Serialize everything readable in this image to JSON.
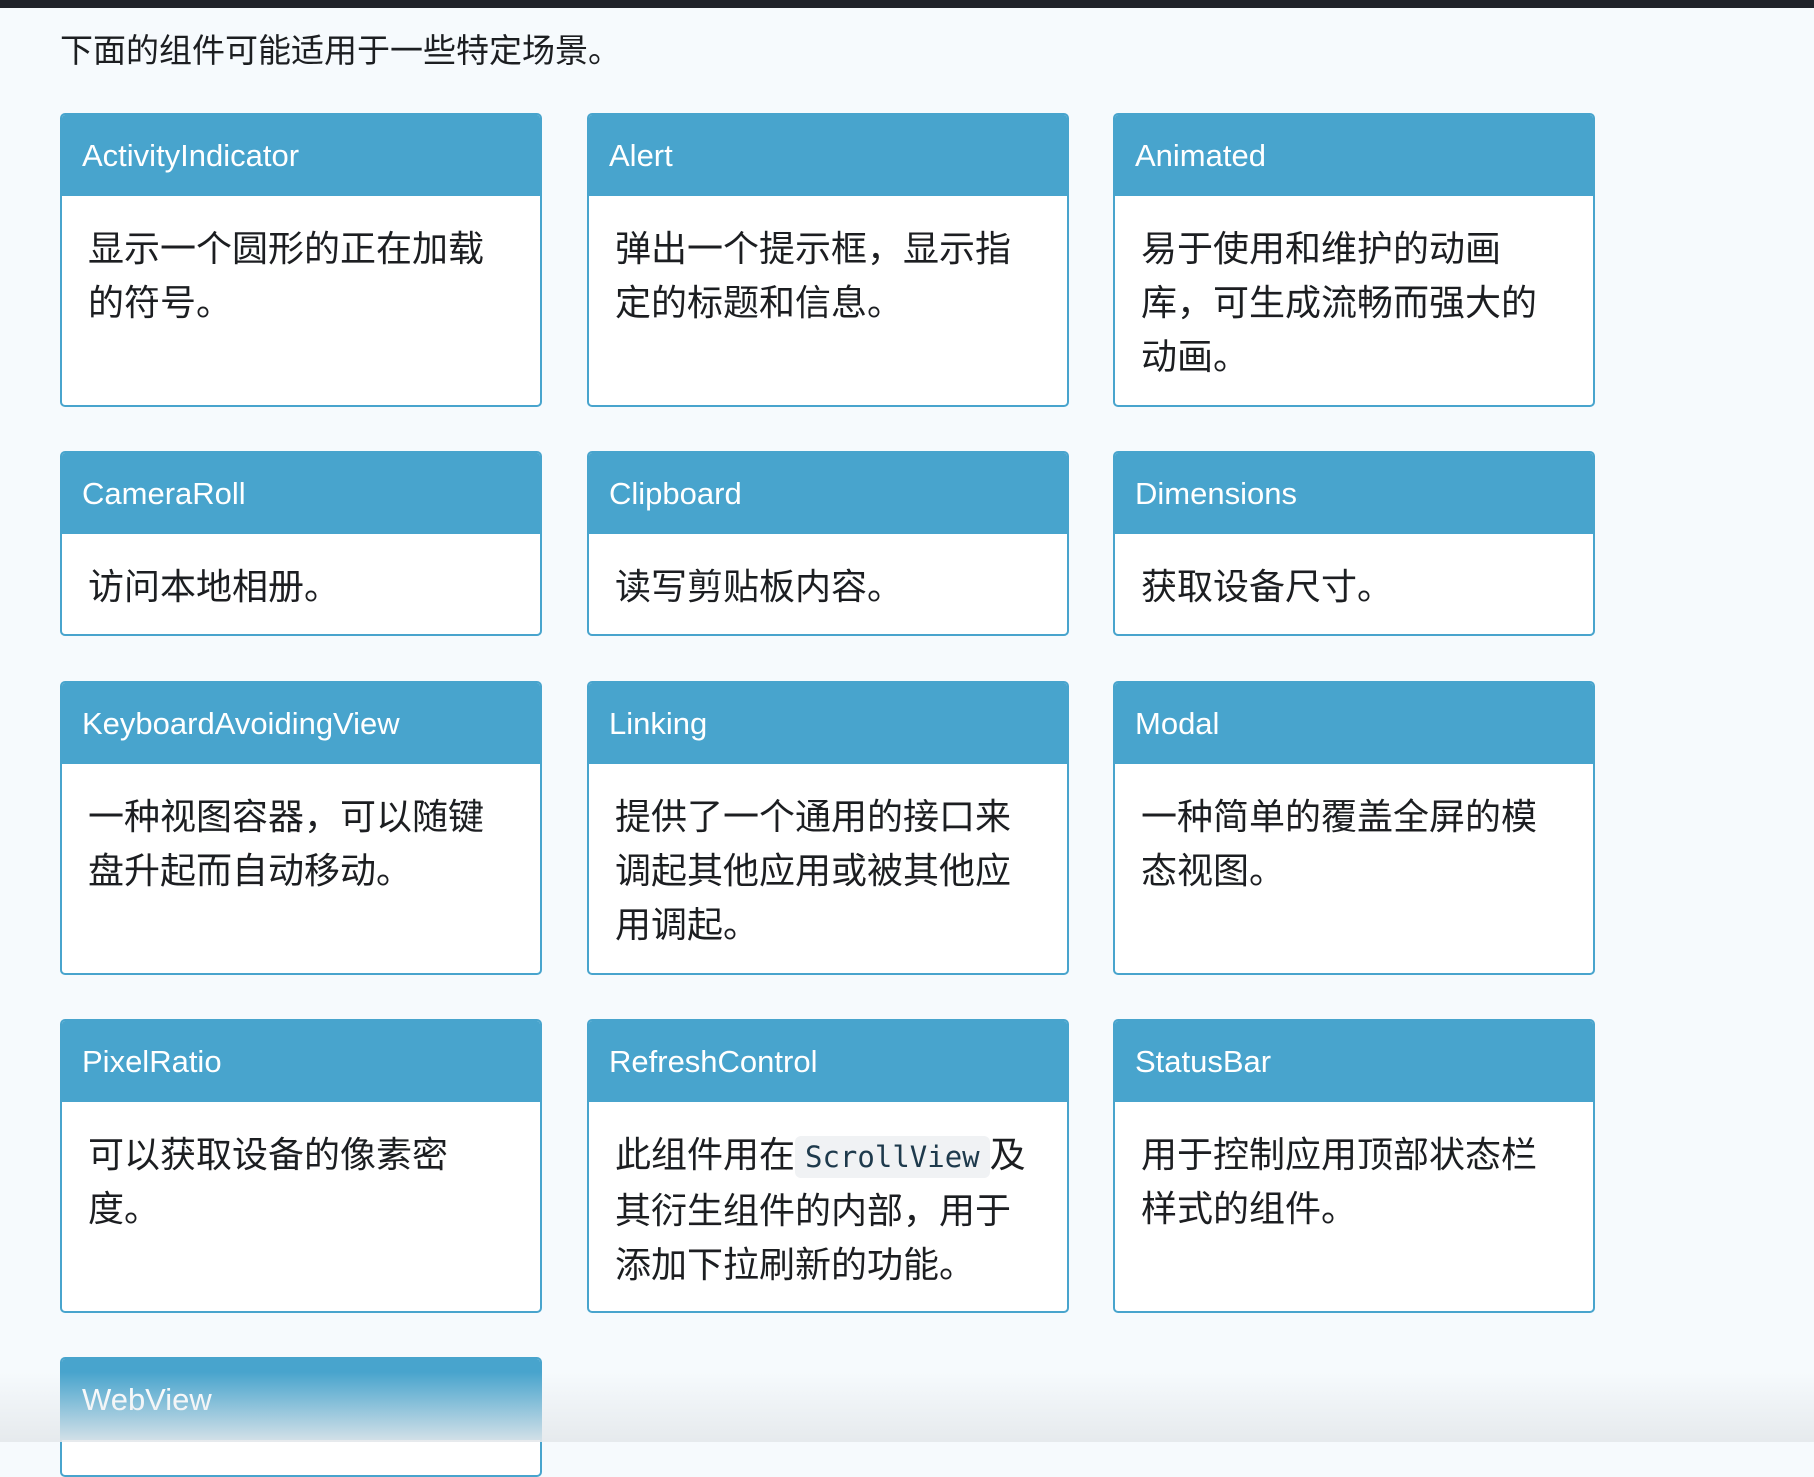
{
  "intro": "下面的组件可能适用于一些特定场景。",
  "cards": [
    {
      "title": "ActivityIndicator",
      "desc": "显示一个圆形的正在加载的符号。"
    },
    {
      "title": "Alert",
      "desc": "弹出一个提示框，显示指定的标题和信息。"
    },
    {
      "title": "Animated",
      "desc": "易于使用和维护的动画库，可生成流畅而强大的动画。"
    },
    {
      "title": "CameraRoll",
      "desc": "访问本地相册。"
    },
    {
      "title": "Clipboard",
      "desc": "读写剪贴板内容。"
    },
    {
      "title": "Dimensions",
      "desc": "获取设备尺寸。"
    },
    {
      "title": "KeyboardAvoidingView",
      "desc": "一种视图容器，可以随键盘升起而自动移动。"
    },
    {
      "title": "Linking",
      "desc": "提供了一个通用的接口来调起其他应用或被其他应用调起。"
    },
    {
      "title": "Modal",
      "desc": "一种简单的覆盖全屏的模态视图。"
    },
    {
      "title": "PixelRatio",
      "desc": "可以获取设备的像素密度。"
    },
    {
      "title": "RefreshControl",
      "desc_before": "此组件用在",
      "desc_code": "ScrollView",
      "desc_after": "及其衍生组件的内部，用于添加下拉刷新的功能。"
    },
    {
      "title": "StatusBar",
      "desc": "用于控制应用顶部状态栏样式的组件。"
    },
    {
      "title": "WebView",
      "desc": ""
    }
  ]
}
